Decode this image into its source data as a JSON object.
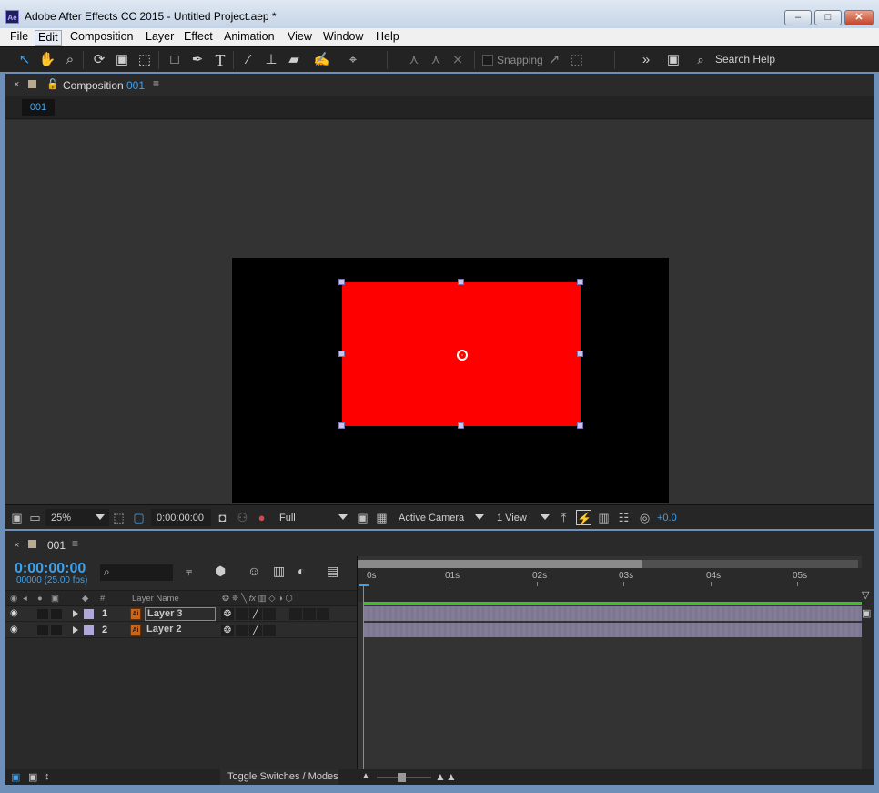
{
  "window": {
    "title": "Adobe After Effects CC 2015 - Untitled Project.aep *",
    "app_icon": "Ae",
    "controls": [
      "minimize-icon",
      "maximize-icon",
      "close-icon"
    ]
  },
  "menu": [
    "File",
    "Edit",
    "Composition",
    "Layer",
    "Effect",
    "Animation",
    "View",
    "Window",
    "Help"
  ],
  "toolbar": {
    "tools": [
      "selection-tool-icon",
      "hand-tool-icon",
      "zoom-tool-icon",
      "rotation-tool-icon",
      "camera-tool-icon",
      "pan-behind-tool-icon",
      "rectangle-tool-icon",
      "pen-tool-icon",
      "text-tool-icon",
      "brush-tool-icon",
      "clone-stamp-tool-icon",
      "eraser-tool-icon",
      "roto-brush-tool-icon",
      "puppet-pin-tool-icon"
    ],
    "snapping_label": "Snapping",
    "search_label": "Search Help"
  },
  "composition": {
    "panel_title": "Composition",
    "comp_name": "001",
    "tab_chip": "001",
    "solid_color": "#ff0000"
  },
  "viewer_footer": {
    "zoom": "25%",
    "timecode": "0:00:00:00",
    "resolution": "Full",
    "camera": "Active Camera",
    "views": "1 View",
    "exposure": "+0.0"
  },
  "timeline": {
    "tab_name": "001",
    "timecode": "0:00:00:00",
    "fps": "00000 (25.00 fps)",
    "col_num": "#",
    "col_layer_name": "Layer Name",
    "ruler_ticks": [
      "0s",
      "01s",
      "02s",
      "03s",
      "04s",
      "05s"
    ],
    "layers": [
      {
        "num": "1",
        "name": "Layer 3",
        "label_color": "#b0a8d8"
      },
      {
        "num": "2",
        "name": "Layer 2",
        "label_color": "#b0a8d8"
      }
    ],
    "toggle_label": "Toggle Switches / Modes"
  }
}
